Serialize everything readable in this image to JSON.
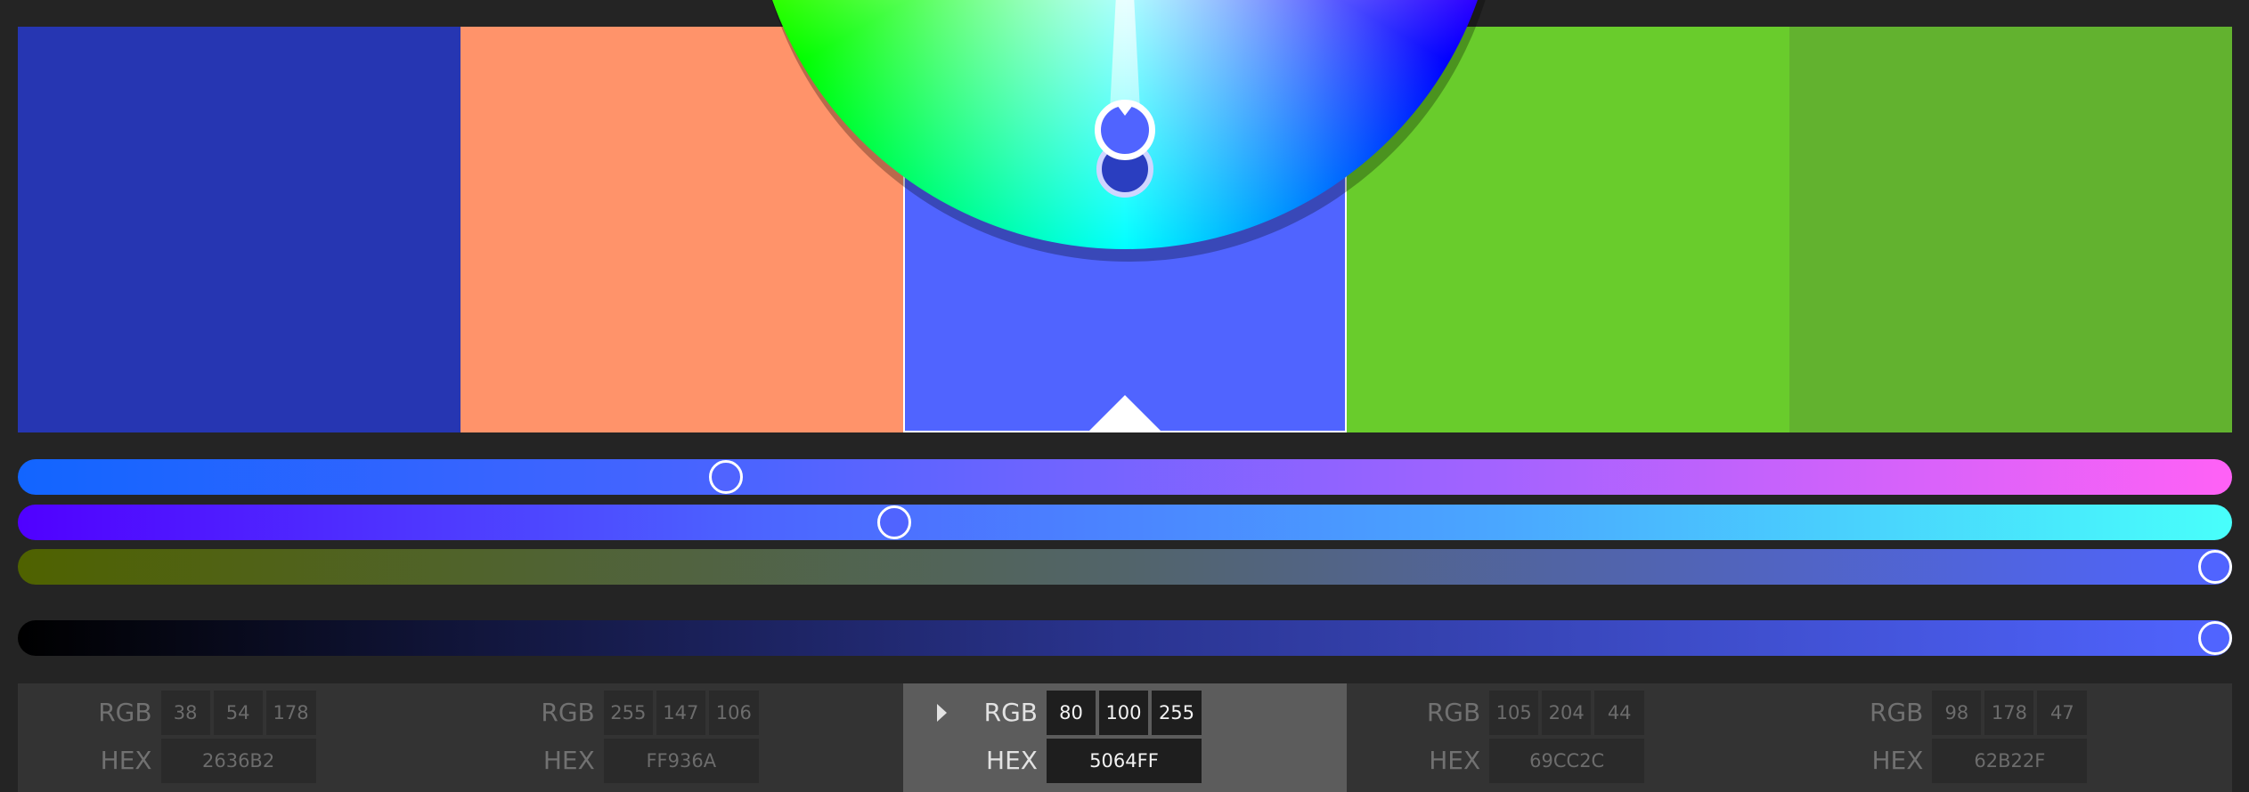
{
  "swatches": [
    {
      "rgb": [
        "38",
        "54",
        "178"
      ],
      "hex": "2636B2",
      "color": "#2636B2",
      "active": false
    },
    {
      "rgb": [
        "255",
        "147",
        "106"
      ],
      "hex": "FF936A",
      "color": "#FF936A",
      "active": false
    },
    {
      "rgb": [
        "80",
        "100",
        "255"
      ],
      "hex": "5064FF",
      "color": "#5064FF",
      "active": true
    },
    {
      "rgb": [
        "105",
        "204",
        "44"
      ],
      "hex": "69CC2C",
      "color": "#69CC2C",
      "active": false
    },
    {
      "rgb": [
        "98",
        "178",
        "47"
      ],
      "hex": "62B22F",
      "color": "#62B22F",
      "active": false
    }
  ],
  "labels": {
    "rgb": "RGB",
    "hex": "HEX"
  },
  "sliders": [
    {
      "name": "slider-1",
      "value": 0.317,
      "gradient": [
        "#1265ff",
        "#4c64ff",
        "#a363ff",
        "#ff61f6"
      ]
    },
    {
      "name": "slider-2",
      "value": 0.394,
      "gradient": [
        "#5000ff",
        "#4c64ff",
        "#4aa6ff",
        "#48fffb"
      ]
    },
    {
      "name": "slider-3",
      "value": 1.0,
      "gradient": [
        "#4f6200",
        "#52646a",
        "#5064ff"
      ]
    },
    {
      "name": "brightness-slider",
      "value": 1.0,
      "gradient": [
        "#000000",
        "#2a3490",
        "#5064ff"
      ]
    }
  ],
  "colors": {
    "accent": "#5064FF",
    "background": "#242424",
    "panel": "#333333",
    "panel_active": "#5c5c5c"
  }
}
